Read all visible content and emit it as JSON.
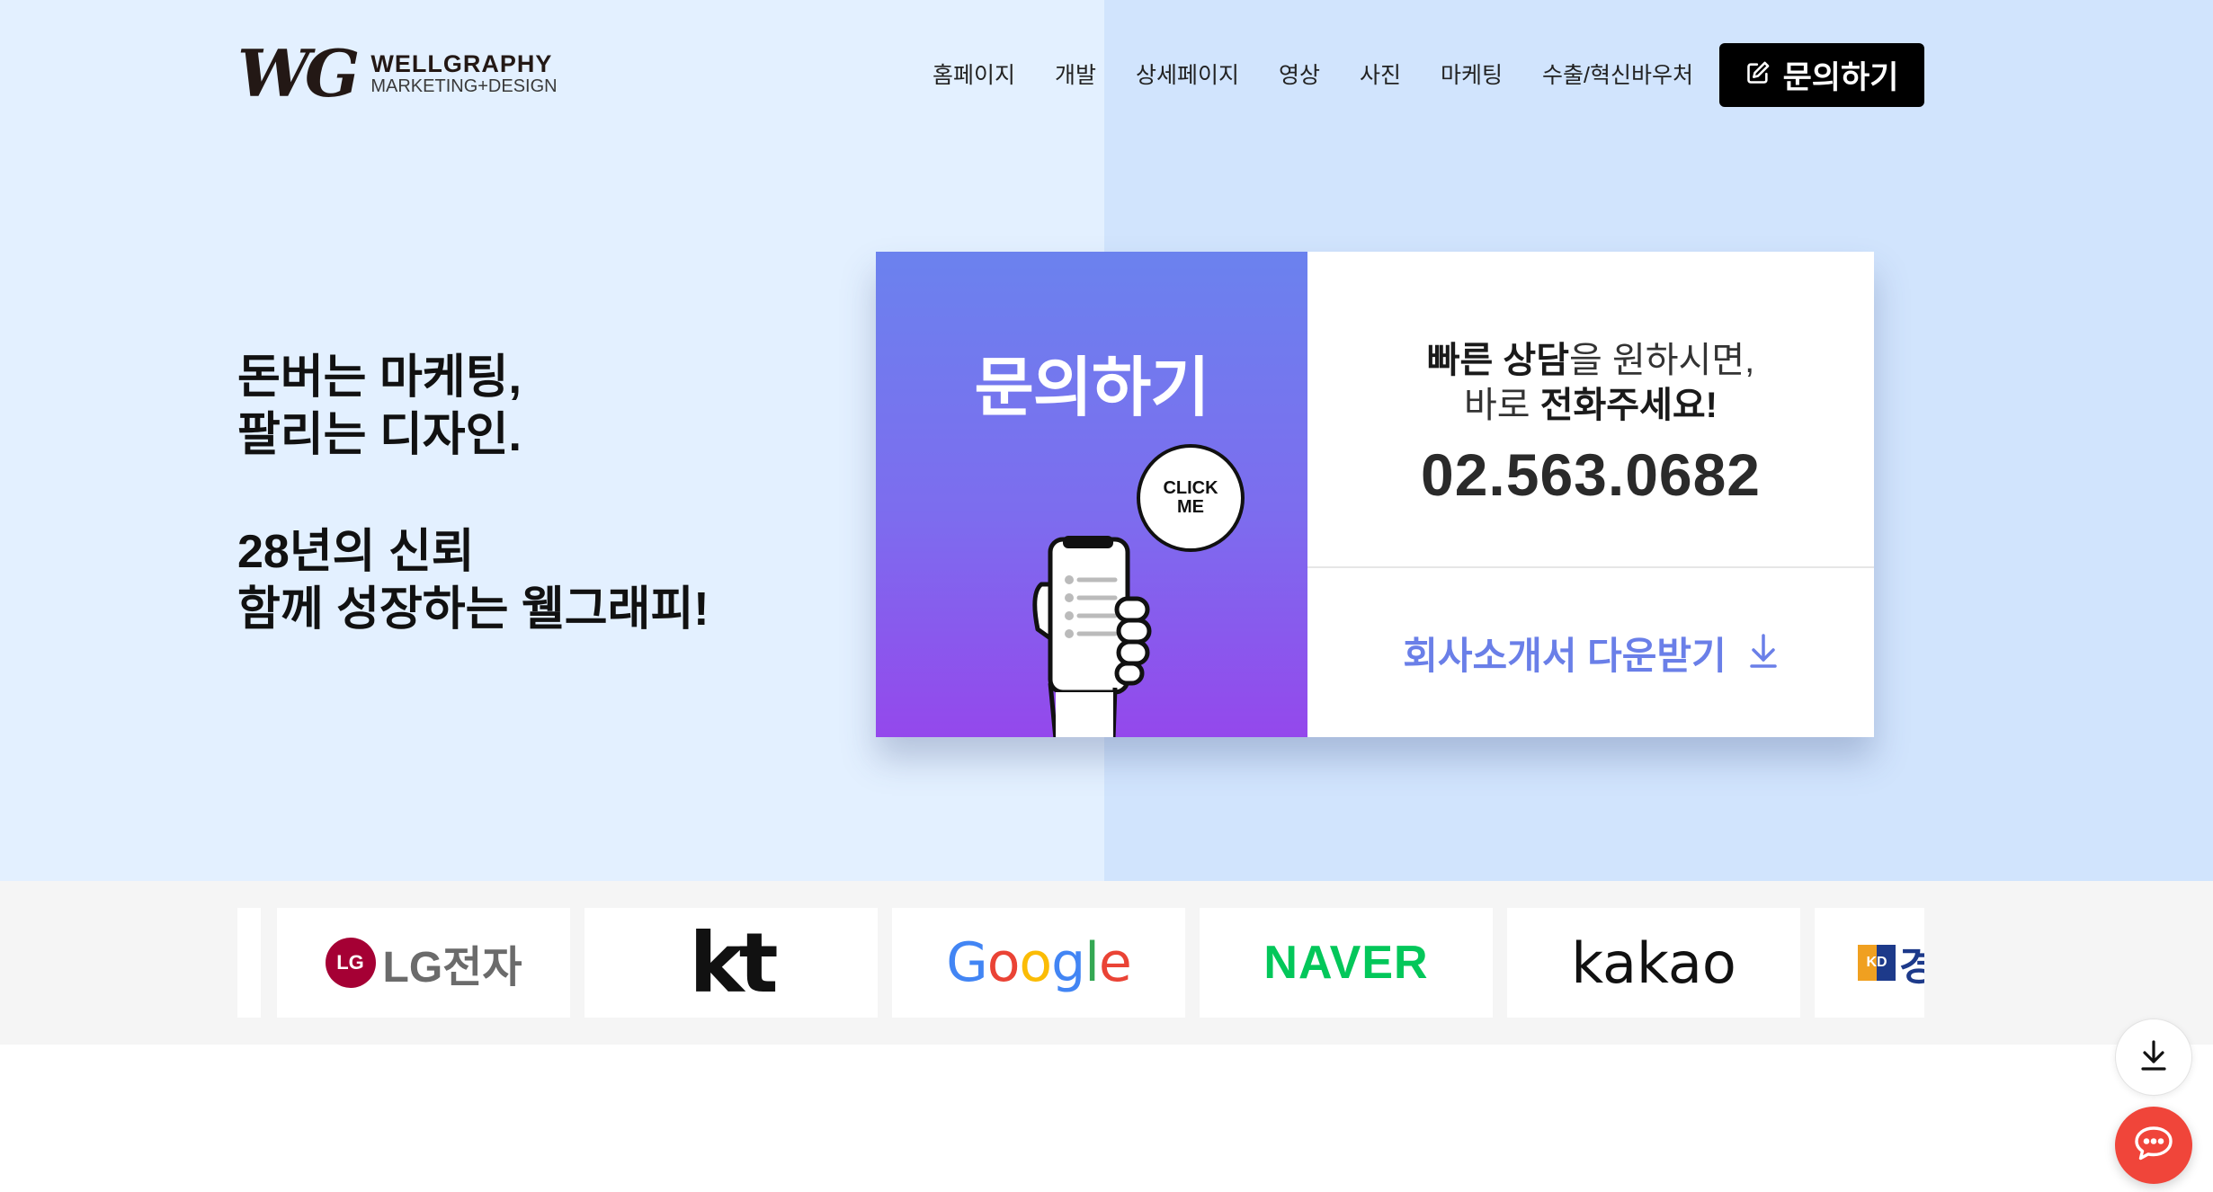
{
  "header": {
    "logo_mark": "WG",
    "logo_name": "WELLGRAPHY",
    "logo_sub": "MARKETING+DESIGN",
    "nav": [
      {
        "label": "홈페이지"
      },
      {
        "label": "개발"
      },
      {
        "label": "상세페이지"
      },
      {
        "label": "영상"
      },
      {
        "label": "사진"
      },
      {
        "label": "마케팅"
      },
      {
        "label": "수출/혁신바우처"
      }
    ],
    "cta_label": "문의하기",
    "cta_icon": "edit-icon"
  },
  "hero": {
    "line1": "돈버는 마케팅,",
    "line2": "팔리는 디자인.",
    "line3": "28년의 신뢰",
    "line4": "함께 성장하는 웰그래피!"
  },
  "contact_card": {
    "title": "문의하기",
    "bubble_line1": "CLICK",
    "bubble_line2": "ME",
    "info1_bold": "빠른 상담",
    "info1_rest": "을 원하시면,",
    "info2_plain": "바로 ",
    "info2_bold": "전화주세요!",
    "phone": "02.563.0682",
    "download_label": "회사소개서 다운받기",
    "download_icon": "arrow-down-icon"
  },
  "partners": {
    "lg_mark": "LG",
    "lg_text": "LG전자",
    "kt": "kt",
    "google": "Google",
    "naver": "NAVER",
    "kakao": "kakao",
    "kd_mark": "KD",
    "kd_text": "경"
  },
  "colors": {
    "hero_left_bg": "#e3f0ff",
    "hero_right_bg": "#d1e4fd",
    "accent_purple": "#6a7fe8",
    "naver_green": "#03c75a",
    "chat_red": "#f0453a"
  }
}
